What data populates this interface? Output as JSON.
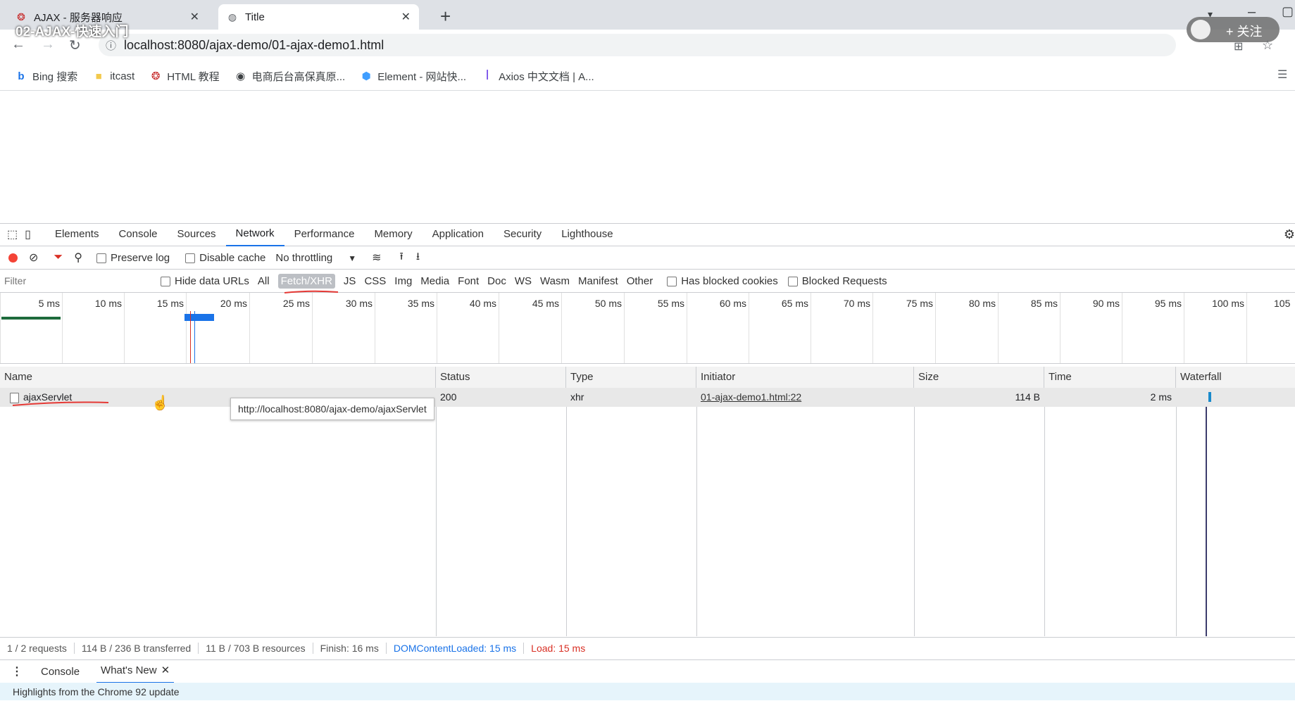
{
  "browser": {
    "tabs": [
      {
        "title": "AJAX - 服务器响应",
        "favicon": "html-tutorial-icon",
        "active": false
      },
      {
        "title": "Title",
        "favicon": "globe-icon",
        "active": true
      }
    ],
    "overlay_title": "02-AJAX-快速入门",
    "follow_label": "+ 关注",
    "url": "localhost:8080/ajax-demo/01-ajax-demo1.html",
    "bookmarks": [
      {
        "label": "Bing 搜索",
        "icon": "bing-icon"
      },
      {
        "label": "itcast",
        "icon": "folder-icon"
      },
      {
        "label": "HTML 教程",
        "icon": "html-tutorial-icon"
      },
      {
        "label": "电商后台高保真原...",
        "icon": "globe-icon"
      },
      {
        "label": "Element - 网站快...",
        "icon": "element-icon"
      },
      {
        "label": "Axios 中文文档 | A...",
        "icon": "axios-icon"
      }
    ]
  },
  "devtools": {
    "tabs": [
      "Elements",
      "Console",
      "Sources",
      "Network",
      "Performance",
      "Memory",
      "Application",
      "Security",
      "Lighthouse"
    ],
    "selected_tab": "Network",
    "toolbar": {
      "preserve_log": "Preserve log",
      "disable_cache": "Disable cache",
      "throttling": "No throttling"
    },
    "filter": {
      "placeholder": "Filter",
      "hide_data_urls": "Hide data URLs",
      "types": [
        "All",
        "Fetch/XHR",
        "JS",
        "CSS",
        "Img",
        "Media",
        "Font",
        "Doc",
        "WS",
        "Wasm",
        "Manifest",
        "Other"
      ],
      "selected_type": "Fetch/XHR",
      "has_blocked_cookies": "Has blocked cookies",
      "blocked_requests": "Blocked Requests"
    },
    "timeline_ticks": [
      "5 ms",
      "10 ms",
      "15 ms",
      "20 ms",
      "25 ms",
      "30 ms",
      "35 ms",
      "40 ms",
      "45 ms",
      "50 ms",
      "55 ms",
      "60 ms",
      "65 ms",
      "70 ms",
      "75 ms",
      "80 ms",
      "85 ms",
      "90 ms",
      "95 ms",
      "100 ms",
      "105"
    ],
    "columns": [
      "Name",
      "Status",
      "Type",
      "Initiator",
      "Size",
      "Time",
      "Waterfall"
    ],
    "rows": [
      {
        "name": "ajaxServlet",
        "status": "200",
        "type": "xhr",
        "initiator": "01-ajax-demo1.html:22",
        "size": "114 B",
        "time": "2 ms"
      }
    ],
    "tooltip": "http://localhost:8080/ajax-demo/ajaxServlet",
    "status_bar": {
      "requests": "1 / 2 requests",
      "transferred": "114 B / 236 B transferred",
      "resources": "11 B / 703 B resources",
      "finish": "Finish: 16 ms",
      "dom_loaded": "DOMContentLoaded: 15 ms",
      "load": "Load: 15 ms"
    },
    "drawer": {
      "tabs": [
        "Console",
        "What's New"
      ],
      "content": "Highlights from the Chrome 92 update"
    }
  },
  "colors": {
    "accent": "#1a73e8",
    "record": "#f44336",
    "dom_loaded": "#1a73e8",
    "load": "#d93025"
  }
}
